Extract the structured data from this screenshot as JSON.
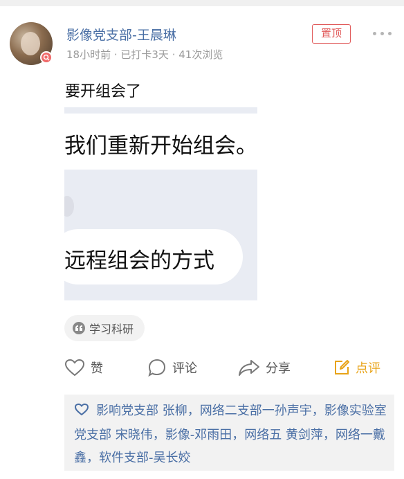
{
  "post": {
    "author": "影像党支部-王晨琳",
    "meta": "18小时前 · 已打卡3天 · 41次浏览",
    "pin_label": "置顶",
    "text": "要开组会了",
    "image": {
      "line1": "我们重新开始组会。",
      "line2": "远程组会的方式"
    },
    "tag": "学习科研",
    "actions": {
      "like": "赞",
      "comment": "评论",
      "share": "分享",
      "review": "点评"
    },
    "likes_text": "影响党支部 张柳，网络二支部一孙声宇，影像实验室党支部 宋晓伟，影像-邓雨田，网络五 黄剑萍，网络一戴鑫，软件支部-吴长姣"
  },
  "colors": {
    "link_blue": "#4a6fa5",
    "pin_red": "#e05858",
    "review_orange": "#e8a317"
  },
  "icons": [
    "more-icon",
    "heart-icon",
    "comment-icon",
    "share-icon",
    "review-icon",
    "quote-icon"
  ]
}
